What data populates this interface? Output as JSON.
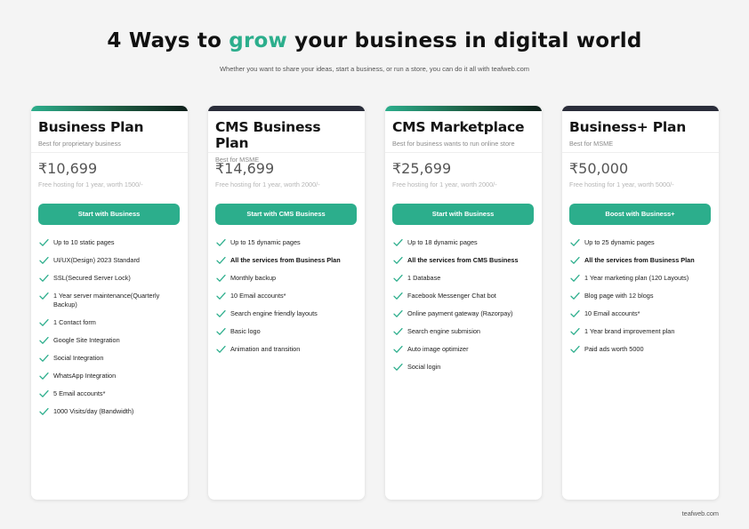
{
  "header": {
    "title_pre": "4 Ways to ",
    "title_accent": "grow",
    "title_post": " your business in digital world",
    "subtitle": "Whether you want to share your ideas, start a business, or run a store, you can do it all with teafweb.com"
  },
  "colors": {
    "accent": "#2cae8c",
    "topbar_green": "#1d5c42",
    "topbar_dark": "#2a2d3a"
  },
  "icons": {
    "feature": "check-icon"
  },
  "plans": [
    {
      "name": "Business Plan",
      "tagline": "Best for proprietary business",
      "price": "₹10,699",
      "hosting": "Free hosting for 1 year,  worth 1500/-",
      "cta": "Start with Business",
      "features": [
        {
          "text": "Up to 10 static pages",
          "bold": false
        },
        {
          "text": "UI/UX(Design) 2023 Standard",
          "bold": false
        },
        {
          "text": " SSL(Secured Server Lock)",
          "bold": false
        },
        {
          "text": "1 Year server maintenance(Quarterly Backup)",
          "bold": false
        },
        {
          "text": "1 Contact form",
          "bold": false
        },
        {
          "text": "Google Site Integration",
          "bold": false
        },
        {
          "text": "Social Integration",
          "bold": false
        },
        {
          "text": "WhatsApp Integration",
          "bold": false
        },
        {
          "text": "5 Email accounts*",
          "bold": false
        },
        {
          "text": "1000 Visits/day (Bandwidth)",
          "bold": false
        }
      ]
    },
    {
      "name": "CMS Business Plan",
      "tagline": "Best for  MSME",
      "price": "₹14,699",
      "hosting": "Free hosting for 1 year, worth 2000/-",
      "cta": "Start with CMS Business",
      "features": [
        {
          "text": "Up to 15 dynamic pages",
          "bold": false
        },
        {
          "text": "All the services from Business Plan",
          "bold": true
        },
        {
          "text": "Monthly backup",
          "bold": false
        },
        {
          "text": "10 Email accounts*",
          "bold": false
        },
        {
          "text": "Search engine friendly layouts",
          "bold": false
        },
        {
          "text": "Basic logo",
          "bold": false
        },
        {
          "text": "Animation and transition",
          "bold": false
        }
      ]
    },
    {
      "name": "CMS Marketplace",
      "tagline": "Best for business wants to run online store",
      "price": "₹25,699",
      "hosting": "Free hosting for 1 year,  worth 2000/-",
      "cta": "Start with Business",
      "features": [
        {
          "text": "Up to 18 dynamic pages",
          "bold": false
        },
        {
          "text": "All the services from CMS Business",
          "bold": true
        },
        {
          "text": "1 Database",
          "bold": false
        },
        {
          "text": "Facebook Messenger Chat bot",
          "bold": false
        },
        {
          "text": "Online payment gateway (Razorpay)",
          "bold": false
        },
        {
          "text": "Search engine submision",
          "bold": false
        },
        {
          "text": "Auto image optimizer",
          "bold": false
        },
        {
          "text": "Social login",
          "bold": false
        }
      ]
    },
    {
      "name": "Business+ Plan",
      "tagline": "Best for  MSME",
      "price": "₹50,000",
      "hosting": "Free hosting for 1 year, worth 5000/-",
      "cta": "Boost with Business+",
      "features": [
        {
          "text": "Up to 25 dynamic pages",
          "bold": false
        },
        {
          "text": "All the services from Business Plan",
          "bold": true
        },
        {
          "text": "1 Year marketing plan (120 Layouts)",
          "bold": false
        },
        {
          "text": "Blog page with 12 blogs",
          "bold": false
        },
        {
          "text": "10 Email accounts*",
          "bold": false
        },
        {
          "text": "1 Year brand improvement plan",
          "bold": false
        },
        {
          "text": "Paid ads worth 5000",
          "bold": false
        }
      ]
    }
  ],
  "footer": {
    "site": "teafweb.com"
  }
}
